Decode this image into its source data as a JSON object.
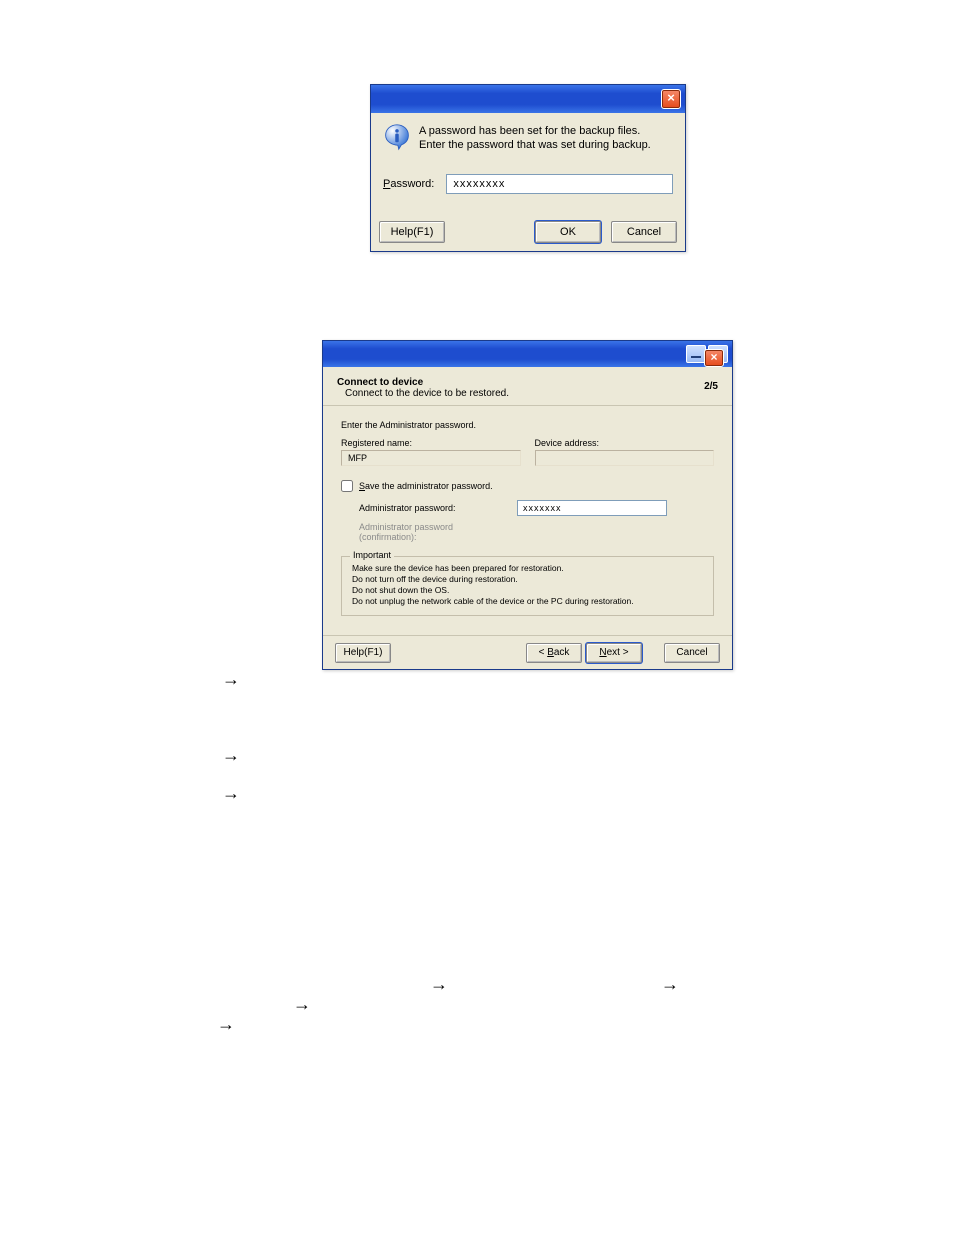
{
  "dialog1": {
    "close_label": "×",
    "message_line1": "A password has been set for the backup files.",
    "message_line2": "Enter the password that was set during backup.",
    "password_label": "Password:",
    "password_underline_char": "P",
    "password_value": "xxxxxxxx",
    "help_label": "Help(F1)",
    "ok_label": "OK",
    "cancel_label": "Cancel"
  },
  "dialog2": {
    "title": "Connect to device",
    "subtitle": "Connect to the device to be restored.",
    "step": "2/5",
    "instruction": "Enter the Administrator password.",
    "registered_name_label": "Registered name:",
    "registered_name_value": "MFP",
    "device_address_label": "Device address:",
    "device_address_value": "",
    "save_pw_label": "Save the administrator password.",
    "save_pw_underline_char": "S",
    "admin_pw_label": "Administrator password:",
    "admin_pw_value": "xxxxxxx",
    "admin_pw_confirm_label": "Administrator password (confirmation):",
    "group_legend": "Important",
    "group_line1": "Make sure the device has been prepared for restoration.",
    "group_line2": "Do not turn off the device during restoration.",
    "group_line3": "Do not shut down the OS.",
    "group_line4": "Do not unplug the network cable of the device or the PC during restoration.",
    "help_label": "Help(F1)",
    "back_label": "< Back",
    "back_ul": "B",
    "next_label": "Next >",
    "next_ul": "N",
    "cancel_label": "Cancel"
  },
  "arrows": {
    "glyph": "→"
  }
}
